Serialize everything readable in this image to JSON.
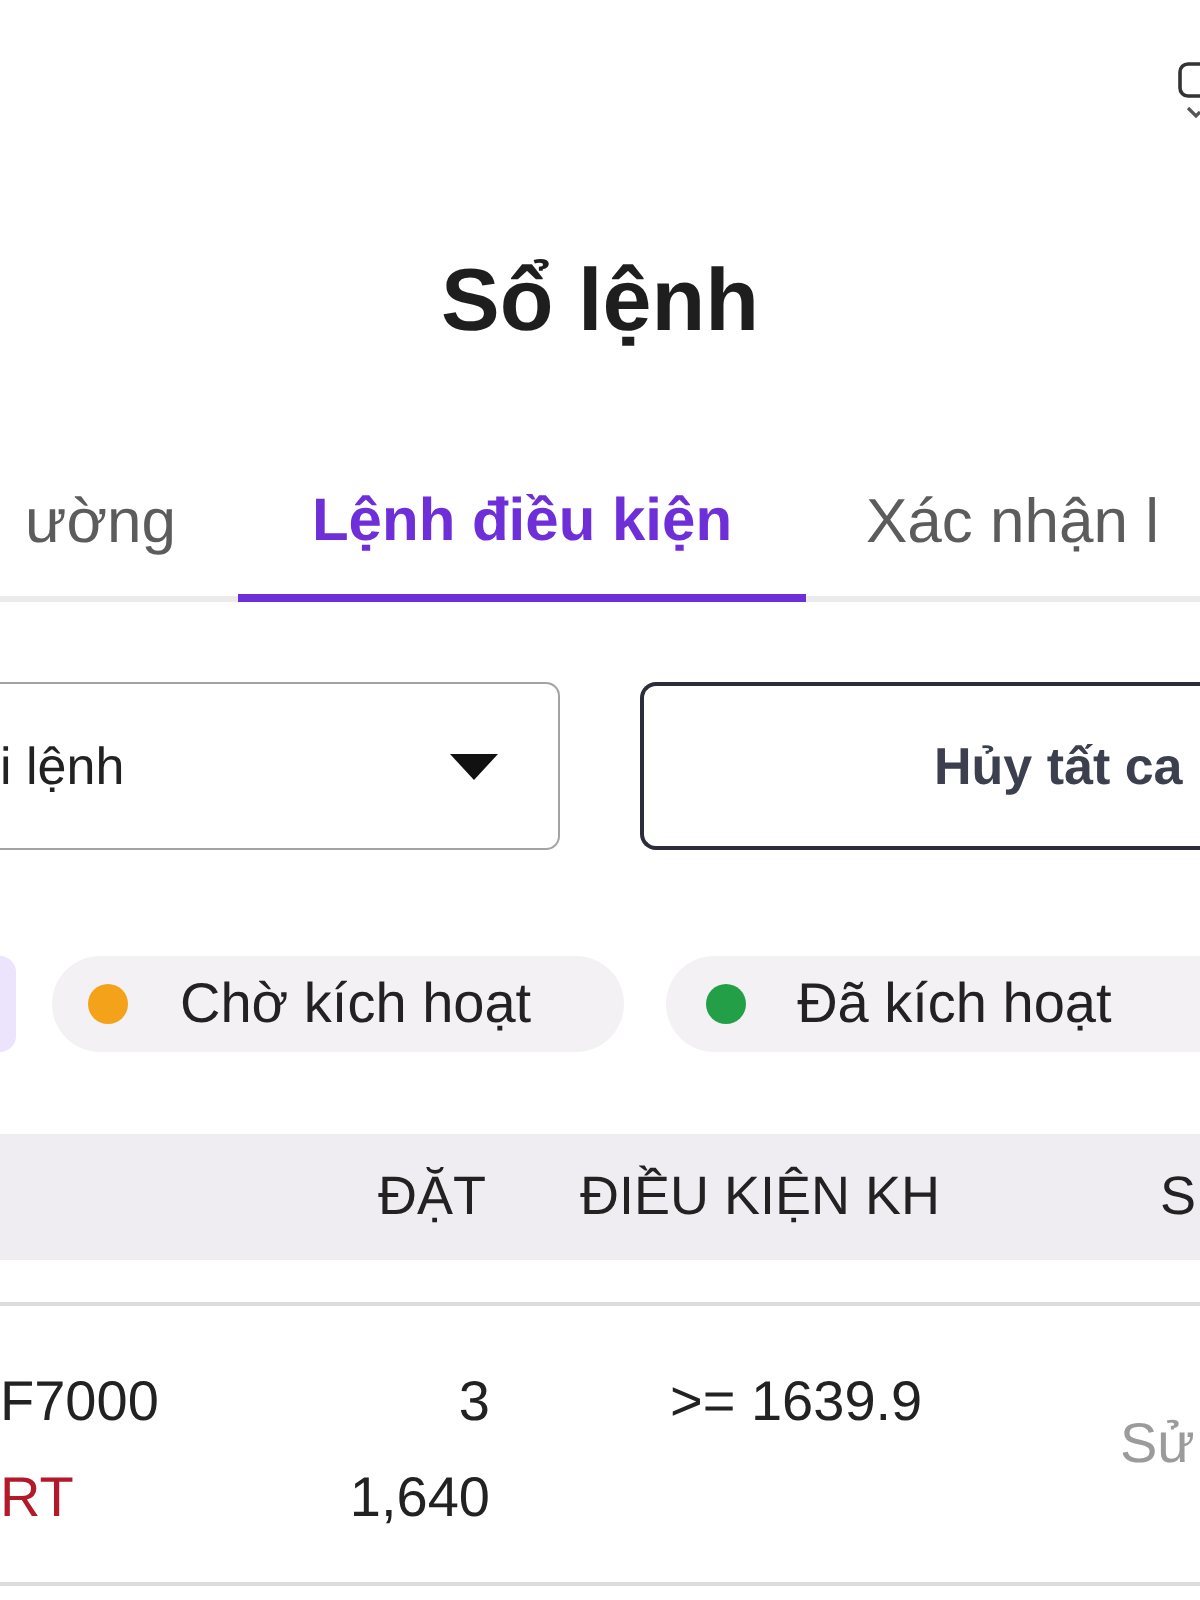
{
  "title": "Sổ lệnh",
  "tabs": [
    {
      "label": "ường",
      "selected": false
    },
    {
      "label": "Lệnh điều kiện",
      "selected": true
    },
    {
      "label": "Xác nhận l",
      "selected": false
    }
  ],
  "dropdown": {
    "value": "i lệnh"
  },
  "cancel_button": {
    "label": "Hủy tất ca"
  },
  "filters": [
    {
      "selected": true
    },
    {
      "label": "Chờ kích hoạt",
      "color": "#f4a21a",
      "selected": false
    },
    {
      "label": "Đã kích hoạt",
      "color": "#23a047",
      "selected": false
    }
  ],
  "table": {
    "columns": [
      "",
      "ĐẶT",
      "ĐIỀU KIỆN KH",
      "S"
    ],
    "rows": [
      {
        "cells": [
          [
            "F7000",
            "RT"
          ],
          [
            "3",
            "1,640"
          ],
          [
            ">= 1639.9"
          ],
          [
            "Sử"
          ]
        ]
      }
    ]
  }
}
